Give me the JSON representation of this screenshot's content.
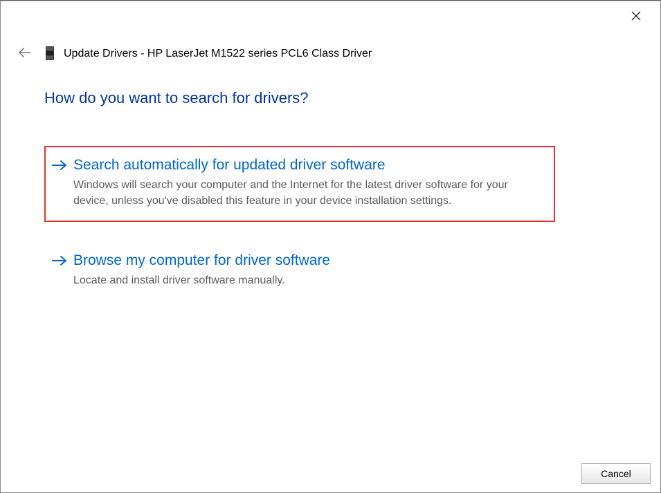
{
  "window": {
    "title": "Update Drivers - HP LaserJet M1522 series PCL6 Class Driver"
  },
  "main": {
    "heading": "How do you want to search for drivers?",
    "options": [
      {
        "title": "Search automatically for updated driver software",
        "description": "Windows will search your computer and the Internet for the latest driver software for your device, unless you've disabled this feature in your device installation settings.",
        "highlighted": true
      },
      {
        "title": "Browse my computer for driver software",
        "description": "Locate and install driver software manually.",
        "highlighted": false
      }
    ]
  },
  "buttons": {
    "cancel": "Cancel"
  }
}
